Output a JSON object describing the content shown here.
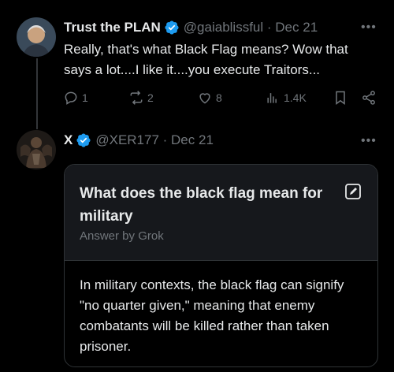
{
  "tweet1": {
    "display_name": "Trust the PLAN",
    "handle": "@gaiablissful",
    "date": "Dec 21",
    "text": "Really, that's what Black Flag means?  Wow that says a lot....I like it....you execute Traitors...",
    "actions": {
      "replies": "1",
      "reposts": "2",
      "likes": "8",
      "views": "1.4K"
    }
  },
  "tweet2": {
    "display_name": "X",
    "handle": "@XER177",
    "date": "Dec 21"
  },
  "grok_card": {
    "title": "What does the black flag mean for military",
    "subtitle": "Answer by Grok",
    "answer": "In military contexts, the black flag can signify \"no quarter given,\" meaning that enemy combatants will be killed rather than taken prisoner."
  },
  "colors": {
    "background": "#000000",
    "verified": "#1d9bf0",
    "muted": "#71767b",
    "text": "#e7e9ea"
  },
  "icons": [
    "verified-badge-icon",
    "more-icon",
    "reply-icon",
    "repost-icon",
    "like-icon",
    "views-icon",
    "bookmark-icon",
    "share-icon",
    "edit-icon"
  ]
}
